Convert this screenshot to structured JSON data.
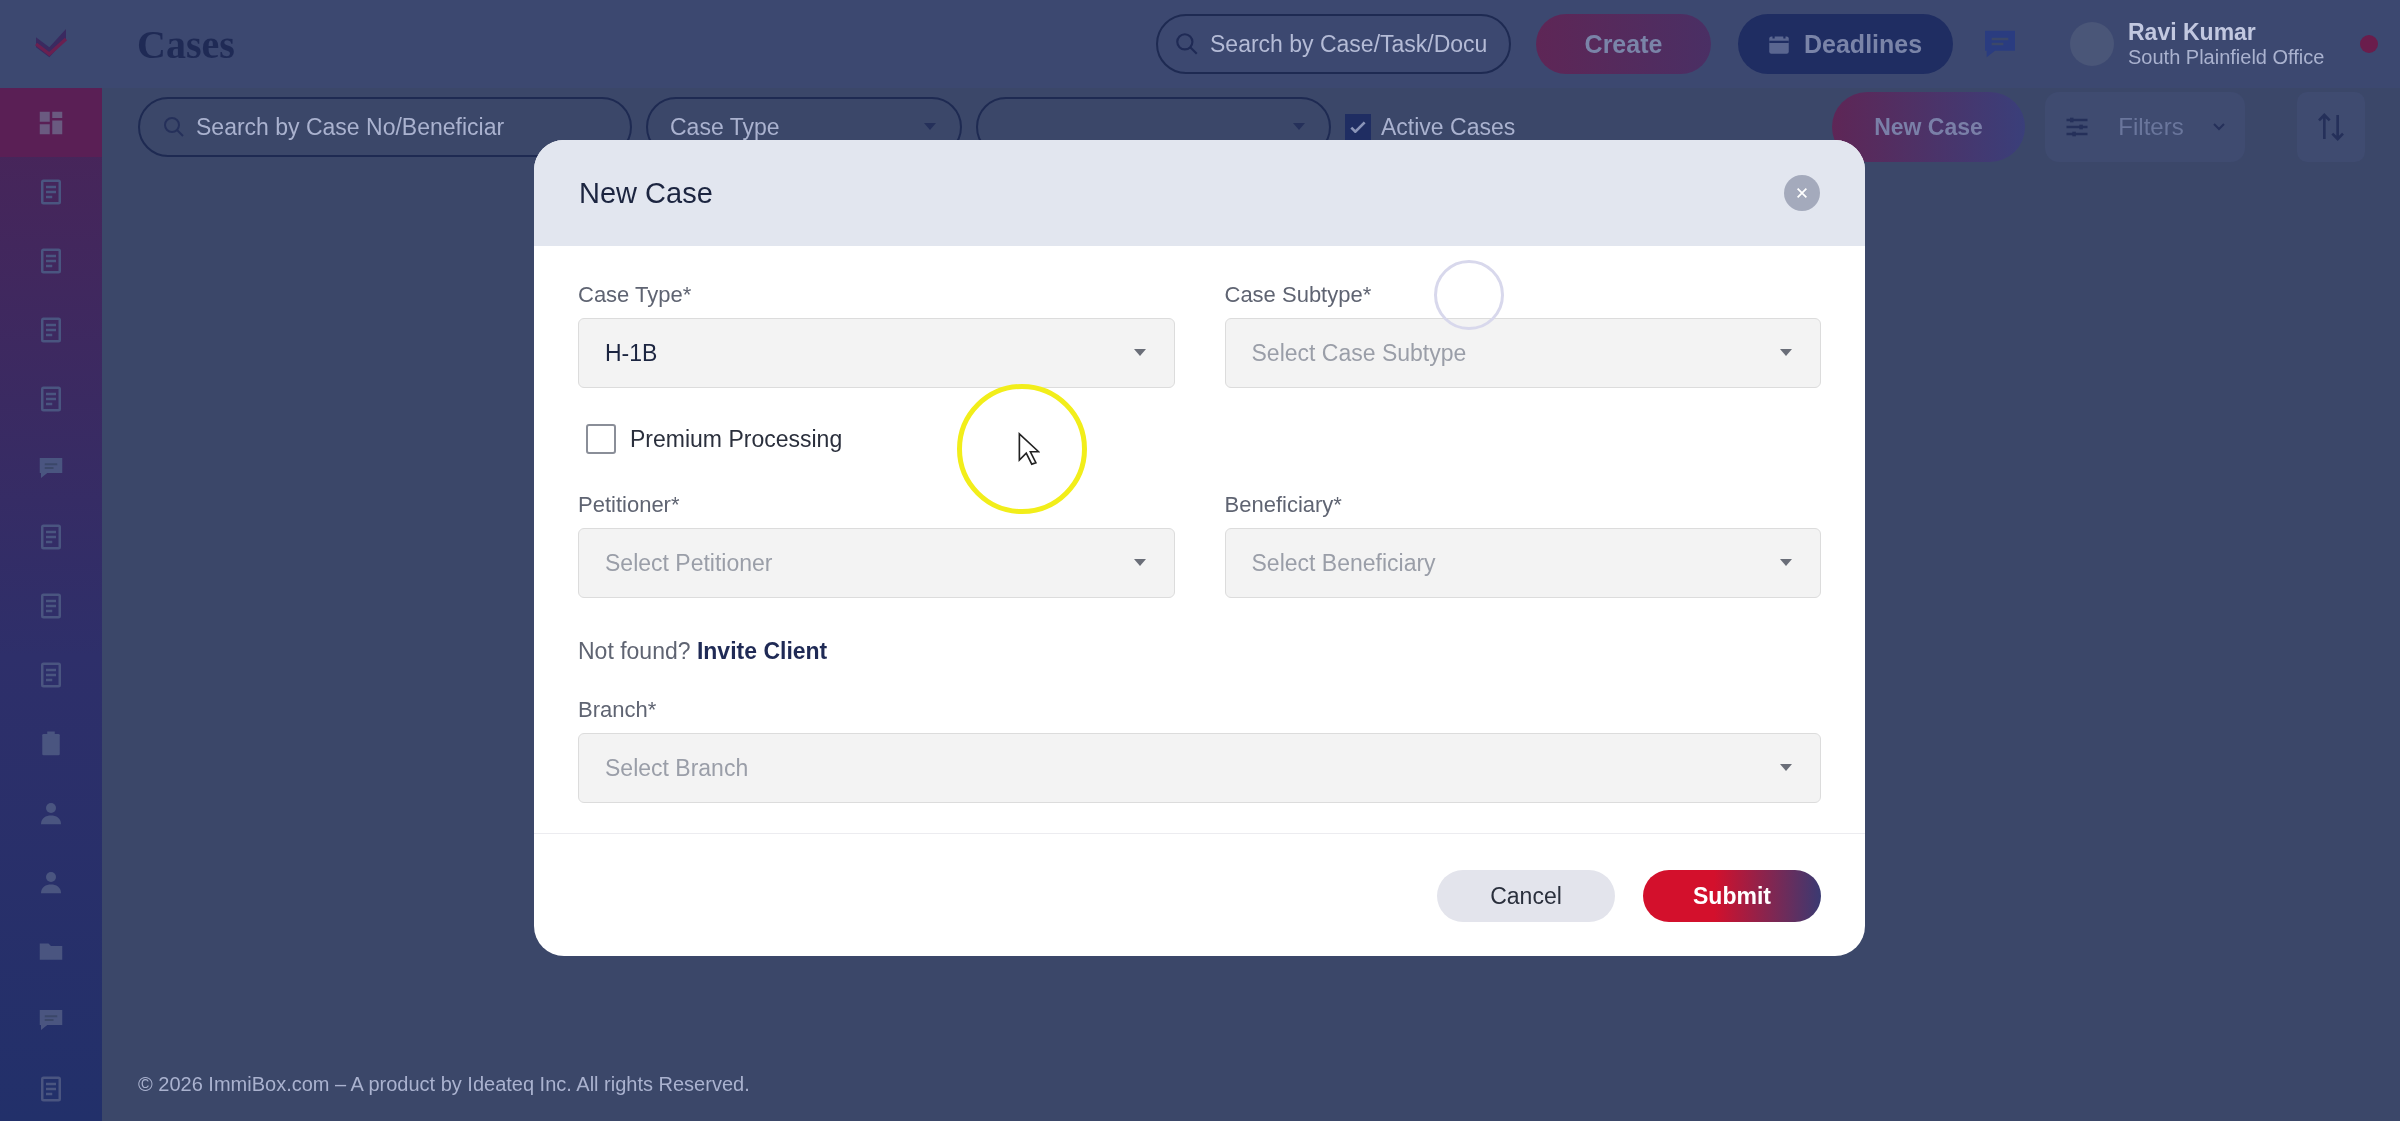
{
  "header": {
    "title": "Cases",
    "search": {
      "placeholder": "Search by Case/Task/Docu"
    },
    "create_button": "Create",
    "deadlines_button": "Deadlines",
    "user": {
      "name": "Ravi Kumar",
      "office": "South Plainfield Office"
    }
  },
  "sidebar": {
    "items": [
      {
        "selected": true
      },
      {
        "selected": false
      },
      {
        "selected": false
      },
      {
        "selected": false
      },
      {
        "selected": false
      },
      {
        "selected": false
      },
      {
        "selected": false
      },
      {
        "selected": false
      },
      {
        "selected": false
      },
      {
        "selected": false
      },
      {
        "selected": false
      },
      {
        "selected": false
      },
      {
        "selected": false
      },
      {
        "selected": false
      },
      {
        "selected": false
      }
    ]
  },
  "filter_bar": {
    "search": {
      "placeholder": "Search by Case No/Beneficiar"
    },
    "case_type": {
      "placeholder": "Case Type"
    },
    "active_cases": {
      "label": "Active Cases",
      "checked": true
    },
    "new_case_button": "New Case",
    "filters_button": "Filters"
  },
  "modal": {
    "title": "New Case",
    "fields": [
      {
        "label": "Case Type*",
        "value": "H-1B"
      },
      {
        "label": "Case Subtype*",
        "placeholder": "Select Case Subtype"
      }
    ],
    "premium_processing": {
      "label": "Premium Processing",
      "checked": false
    },
    "party_fields": [
      {
        "label": "Petitioner*",
        "placeholder": "Select Petitioner"
      },
      {
        "label": "Beneficiary*",
        "placeholder": "Select Beneficiary"
      }
    ],
    "invite": {
      "text": "Not found?",
      "link": "Invite Client"
    },
    "branch": {
      "label": "Branch*",
      "placeholder": "Select Branch"
    },
    "buttons": [
      {
        "label": "Cancel",
        "kind": "secondary"
      },
      {
        "label": "Submit",
        "kind": "primary"
      }
    ]
  },
  "footer": "© 2026 ImmiBox.com – A product by Ideateq Inc. All rights Reserved."
}
